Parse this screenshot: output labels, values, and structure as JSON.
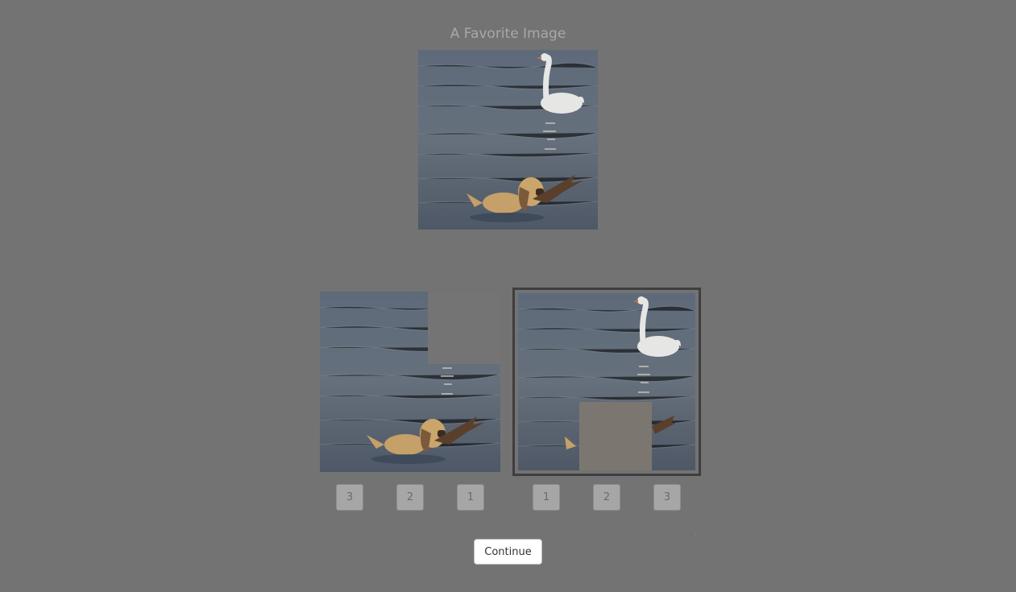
{
  "title": "A Favorite Image",
  "images": {
    "hero": {
      "subject": "dog-and-swan-photo"
    },
    "option_left": {
      "subject": "dog-photo-with-swan-masked"
    },
    "option_right": {
      "subject": "swan-photo-with-dog-masked",
      "selected": true
    }
  },
  "rank_buttons": {
    "left": [
      "3",
      "2",
      "1"
    ],
    "right": [
      "1",
      "2",
      "3"
    ]
  },
  "continue_label": "Continue",
  "colors": {
    "background": "#737373",
    "selected_border": "#3e3e3e",
    "button_bg": "#a6a6a6"
  }
}
